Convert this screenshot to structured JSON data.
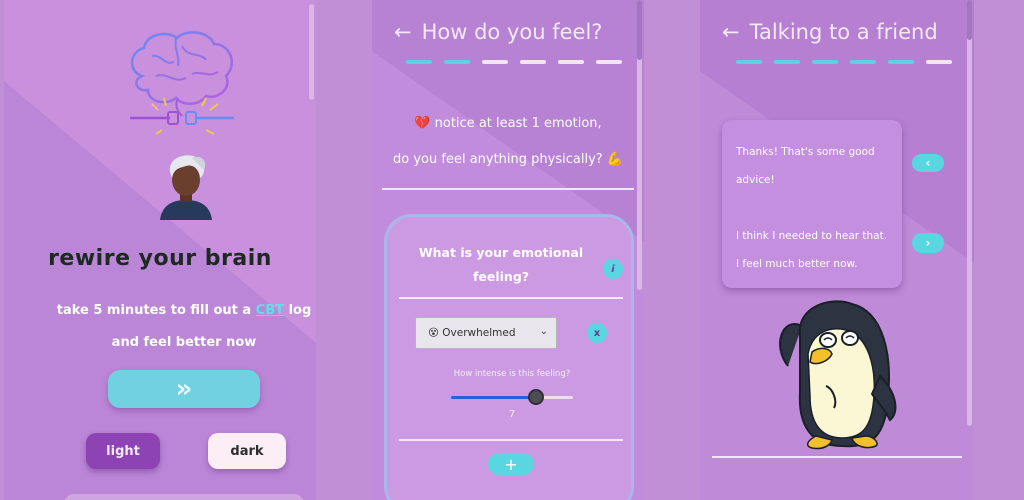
{
  "screen1": {
    "title": "rewire your brain",
    "subtitle_before": "take 5 minutes to fill out a ",
    "subtitle_link": "CBT",
    "subtitle_after": " log and feel better now",
    "next_glyph": "»",
    "light_label": "light",
    "dark_label": "dark"
  },
  "screen2": {
    "back_glyph": "←",
    "title": "How do you feel?",
    "progress": {
      "completed": 2,
      "total": 6
    },
    "prompt1": "💔 notice at least 1 emotion,",
    "prompt2": "do you feel anything physically? 💪",
    "card": {
      "question": "What is your emotional feeling?",
      "info_glyph": "i",
      "selected_option": "😵 Overwhelmed",
      "remove_glyph": "x",
      "intensity_label": "How intense is this feeling?",
      "intensity_value": "7",
      "intensity_fraction": 0.7,
      "add_glyph": "+"
    }
  },
  "screen3": {
    "back_glyph": "←",
    "title": "Talking to a friend",
    "progress": {
      "completed": 5,
      "total": 6
    },
    "message_line1": "Thanks! That's some good",
    "message_line2": "advice!",
    "message_line3": "I think I needed to hear that.",
    "message_line4": "I feel much better now.",
    "prev_glyph": "‹",
    "next_glyph": "›"
  },
  "colors": {
    "accent_cyan": "#5ad6e2",
    "purple_button": "#8e43b4",
    "slider_blue": "#2a5fd8"
  }
}
